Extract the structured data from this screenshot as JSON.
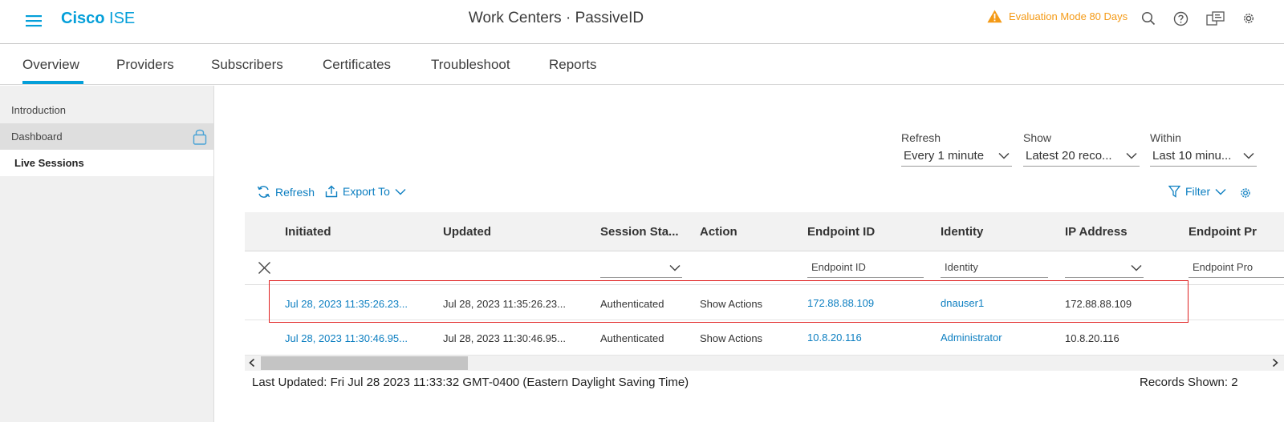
{
  "header": {
    "brand_bold": "Cisco",
    "brand_light": "ISE",
    "title": "Work Centers · PassiveID",
    "eval_text": "Evaluation Mode 80 Days",
    "icons": [
      "menu-icon",
      "warning-icon",
      "search-icon",
      "help-icon",
      "notifications-icon",
      "settings-icon"
    ]
  },
  "tabs": [
    {
      "label": "Overview",
      "active": true
    },
    {
      "label": "Providers"
    },
    {
      "label": "Subscribers"
    },
    {
      "label": "Certificates"
    },
    {
      "label": "Troubleshoot"
    },
    {
      "label": "Reports"
    }
  ],
  "sidebar": {
    "items": [
      {
        "label": "Introduction"
      },
      {
        "label": "Dashboard"
      },
      {
        "label": "Live Sessions",
        "active": true
      }
    ]
  },
  "controls": {
    "refresh": {
      "label": "Refresh",
      "value": "Every 1 minute"
    },
    "show": {
      "label": "Show",
      "value": "Latest 20 reco..."
    },
    "within": {
      "label": "Within",
      "value": "Last 10 minu..."
    }
  },
  "toolbar": {
    "refresh_label": "Refresh",
    "export_label": "Export To",
    "filter_label": "Filter"
  },
  "table": {
    "columns": [
      "Initiated",
      "Updated",
      "Session Sta...",
      "Action",
      "Endpoint ID",
      "Identity",
      "IP Address",
      "Endpoint Pr"
    ],
    "filter_placeholders": {
      "endpoint_id": "Endpoint ID",
      "identity": "Identity",
      "endpoint_profile": "Endpoint Pro"
    },
    "rows": [
      {
        "initiated": "Jul 28, 2023 11:35:26.23...",
        "updated": "Jul 28, 2023 11:35:26.23...",
        "status": "Authenticated",
        "action": "Show Actions",
        "endpoint_id": "172.88.88.109",
        "identity": "dnauser1",
        "ip": "172.88.88.109"
      },
      {
        "initiated": "Jul 28, 2023 11:30:46.95...",
        "updated": "Jul 28, 2023 11:30:46.95...",
        "status": "Authenticated",
        "action": "Show Actions",
        "endpoint_id": "10.8.20.116",
        "identity": "Administrator",
        "ip": "10.8.20.116"
      }
    ]
  },
  "footer": {
    "last_updated": "Last Updated: Fri Jul 28 2023 11:33:32 GMT-0400 (Eastern Daylight Saving Time)",
    "records_shown": "Records Shown: 2"
  },
  "colors": {
    "accent": "#049fd9",
    "link": "#0d7fc1",
    "warning": "#f49a16",
    "highlight_border": "#e02020"
  }
}
